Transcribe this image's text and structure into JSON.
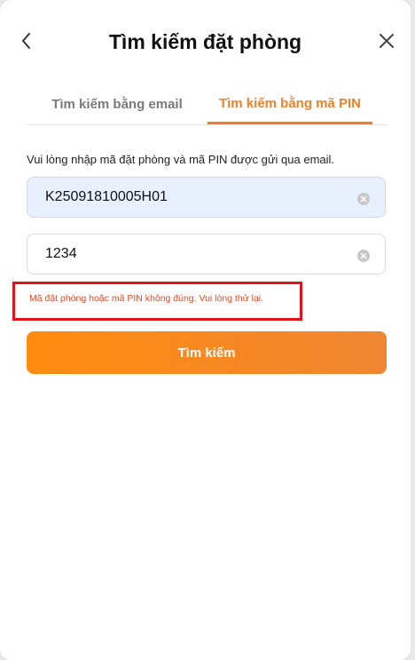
{
  "header": {
    "title": "Tìm kiếm đặt phòng",
    "back_icon": "chevron-left-icon",
    "close_icon": "close-icon"
  },
  "tabs": [
    {
      "label": "Tìm kiếm bằng email",
      "active": false
    },
    {
      "label": "Tìm kiếm bằng mã PIN",
      "active": true
    }
  ],
  "form": {
    "instruction": "Vui lòng nhập mã đặt phòng và mã PIN được gửi qua email.",
    "booking_code": {
      "value": "K25091810005H01"
    },
    "pin": {
      "value": "1234"
    },
    "error": "Mã đặt phòng hoặc mã PIN không đúng. Vui lòng thử lại.",
    "submit_label": "Tìm kiếm"
  },
  "colors": {
    "accent": "#f0812a",
    "error": "#e24a2b",
    "highlight_border": "#e1141c",
    "autofill_bg": "#e8f0fe"
  }
}
